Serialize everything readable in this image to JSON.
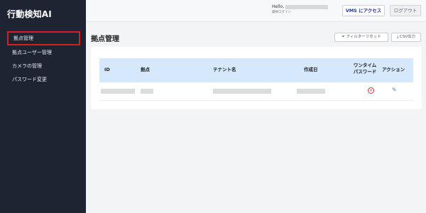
{
  "app": {
    "title": "行動検知AI"
  },
  "sidebar": {
    "items": [
      {
        "label": "拠点管理",
        "active": true
      },
      {
        "label": "拠点ユーザー管理"
      },
      {
        "label": "カメラの管理"
      },
      {
        "label": "パスワード変更"
      }
    ]
  },
  "header": {
    "greeting": "Hello,",
    "login_note": "最終ログイン",
    "vms_button": "VMS にアクセス",
    "logout_button": "ログアウト"
  },
  "main": {
    "title": "拠点管理",
    "filter_reset": "⏷ フィルターリセット",
    "csv_export": "⤓ CSV出力"
  },
  "table": {
    "columns": {
      "id": "ID",
      "site": "拠点",
      "tenant": "テナント名",
      "created": "作成日",
      "otp_line1": "ワンタイム",
      "otp_line2": "パスワード",
      "action": "アクション"
    }
  },
  "colors": {
    "sidebar_bg": "#1f2433",
    "header_row_bg": "#d6e8fb",
    "accent": "#1e3a8a",
    "danger": "#d93030"
  },
  "icons": {
    "otp_status": "close-circle-icon",
    "action": "edit-icon"
  }
}
